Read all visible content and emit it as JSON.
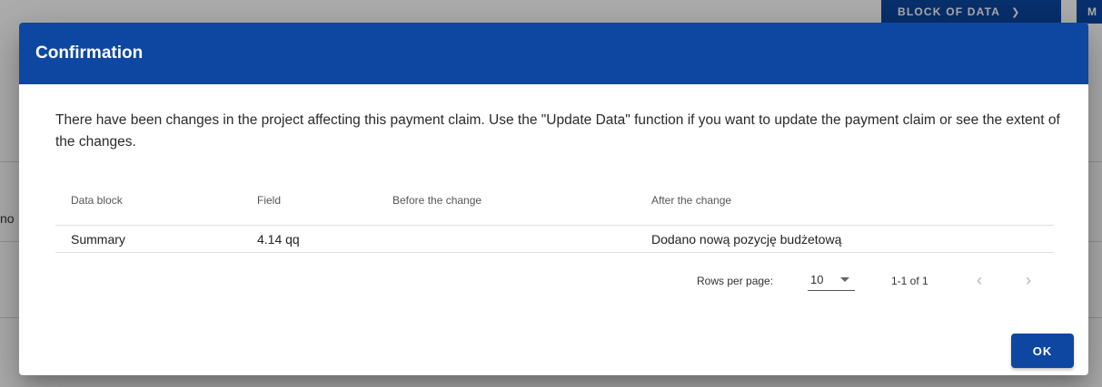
{
  "background": {
    "block_button_label": "BLOCK OF DATA",
    "more_button_label": "M",
    "side_text": "no"
  },
  "dialog": {
    "title": "Confirmation",
    "message": "There have been changes in the project affecting this payment claim. Use the \"Update Data\" function if you want to update the payment claim or see the extent of the changes.",
    "table": {
      "columns": [
        "Data block",
        "Field",
        "Before the change",
        "After the change"
      ],
      "rows": [
        [
          "Summary",
          "4.14 qq",
          "",
          "Dodano nową pozycję budżetową"
        ]
      ]
    },
    "pagination": {
      "rows_per_page_label": "Rows per page:",
      "rows_per_page_value": "10",
      "range": "1-1 of 1",
      "prev": "‹",
      "next": "›"
    },
    "ok_label": "OK"
  },
  "colors": {
    "primary": "#0d47a1",
    "overlay": "rgba(0,0,0,0.32)"
  }
}
